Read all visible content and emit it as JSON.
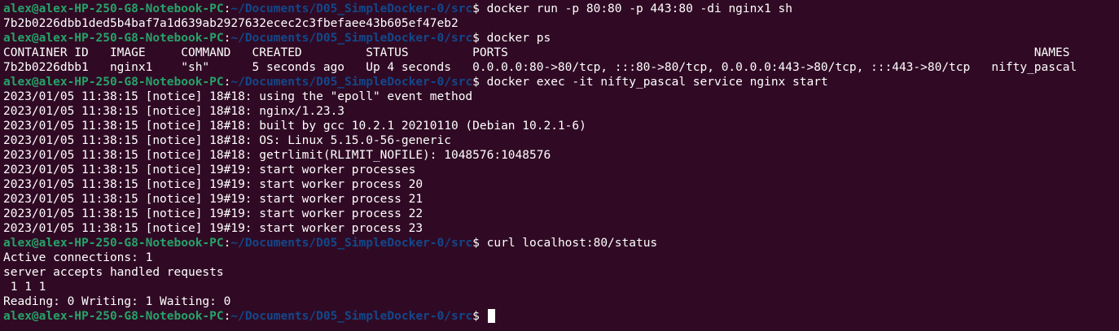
{
  "prompt": {
    "user": "alex@alex-HP-250-G8-Notebook-PC",
    "sep": ":",
    "path": "~/Documents/D05_SimpleDocker-0/src",
    "sign": "$ "
  },
  "lines": [
    {
      "type": "cmd",
      "text": "docker run -p 80:80 -p 443:80 -di nginx1 sh"
    },
    {
      "type": "out",
      "text": "7b2b0226dbb1ded5b4baf7a1d639ab2927632ecec2c3fbefaee43b605ef47eb2"
    },
    {
      "type": "cmd",
      "text": "docker ps"
    },
    {
      "type": "out",
      "text": "CONTAINER ID   IMAGE     COMMAND   CREATED         STATUS         PORTS                                                                          NAMES"
    },
    {
      "type": "out",
      "text": "7b2b0226dbb1   nginx1    \"sh\"      5 seconds ago   Up 4 seconds   0.0.0.0:80->80/tcp, :::80->80/tcp, 0.0.0.0:443->80/tcp, :::443->80/tcp   nifty_pascal"
    },
    {
      "type": "cmd",
      "text": "docker exec -it nifty_pascal service nginx start"
    },
    {
      "type": "out",
      "text": "2023/01/05 11:38:15 [notice] 18#18: using the \"epoll\" event method"
    },
    {
      "type": "out",
      "text": "2023/01/05 11:38:15 [notice] 18#18: nginx/1.23.3"
    },
    {
      "type": "out",
      "text": "2023/01/05 11:38:15 [notice] 18#18: built by gcc 10.2.1 20210110 (Debian 10.2.1-6)"
    },
    {
      "type": "out",
      "text": "2023/01/05 11:38:15 [notice] 18#18: OS: Linux 5.15.0-56-generic"
    },
    {
      "type": "out",
      "text": "2023/01/05 11:38:15 [notice] 18#18: getrlimit(RLIMIT_NOFILE): 1048576:1048576"
    },
    {
      "type": "out",
      "text": "2023/01/05 11:38:15 [notice] 19#19: start worker processes"
    },
    {
      "type": "out",
      "text": "2023/01/05 11:38:15 [notice] 19#19: start worker process 20"
    },
    {
      "type": "out",
      "text": "2023/01/05 11:38:15 [notice] 19#19: start worker process 21"
    },
    {
      "type": "out",
      "text": "2023/01/05 11:38:15 [notice] 19#19: start worker process 22"
    },
    {
      "type": "out",
      "text": "2023/01/05 11:38:15 [notice] 19#19: start worker process 23"
    },
    {
      "type": "cmd",
      "text": "curl localhost:80/status"
    },
    {
      "type": "out",
      "text": "Active connections: 1"
    },
    {
      "type": "out",
      "text": "server accepts handled requests"
    },
    {
      "type": "out",
      "text": " 1 1 1"
    },
    {
      "type": "out",
      "text": "Reading: 0 Writing: 1 Waiting: 0"
    },
    {
      "type": "cmd",
      "text": "",
      "cursor": true
    }
  ],
  "colors": {
    "background": "#300a24",
    "prompt_user": "#26a269",
    "prompt_path": "#12488b",
    "text": "#ffffff"
  }
}
